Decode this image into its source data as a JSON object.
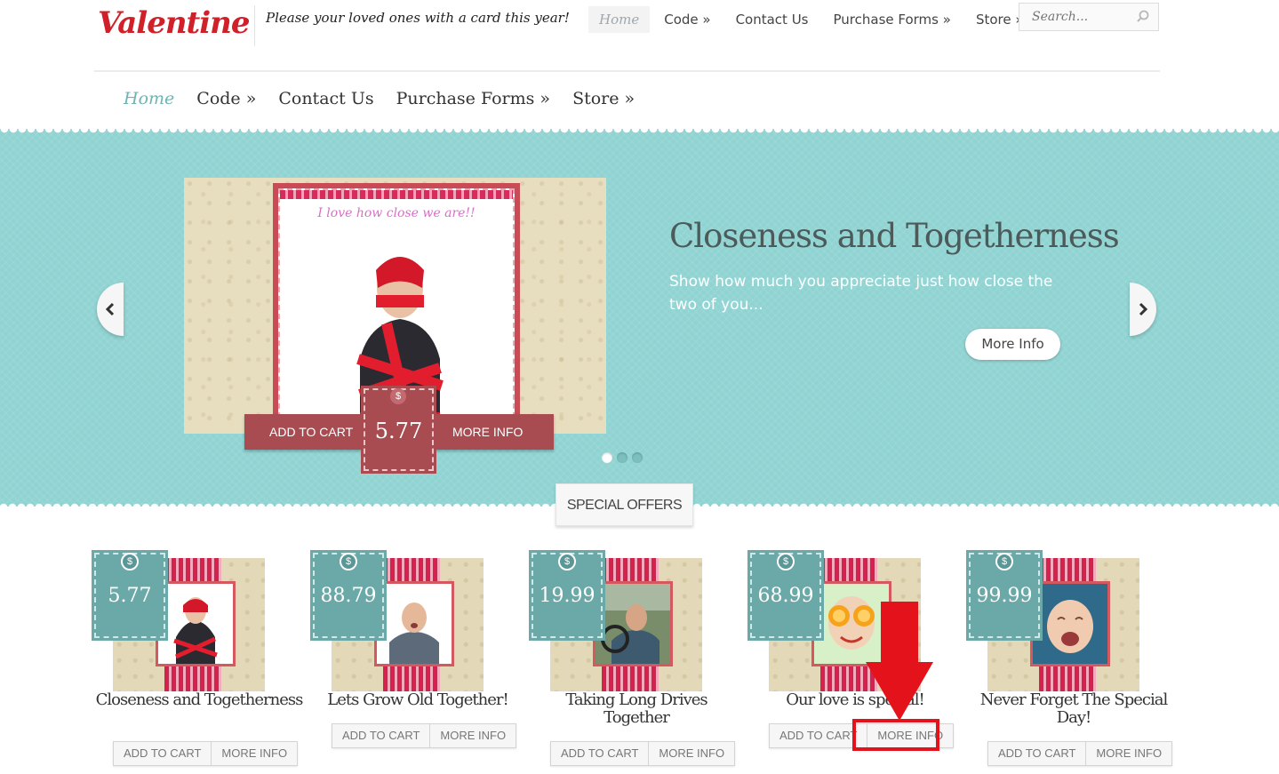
{
  "header": {
    "logo": "Valentine",
    "tagline": "Please your loved ones with a card this year!",
    "topnav": [
      {
        "label": "Home"
      },
      {
        "label": "Code »"
      },
      {
        "label": "Contact Us"
      },
      {
        "label": "Purchase Forms »"
      },
      {
        "label": "Store »"
      }
    ],
    "search_placeholder": "Search..."
  },
  "mainnav": [
    {
      "label": "Home"
    },
    {
      "label": "Code »"
    },
    {
      "label": "Contact Us"
    },
    {
      "label": "Purchase Forms »"
    },
    {
      "label": "Store »"
    }
  ],
  "slider": {
    "card_caption": "I love how close we are!!",
    "add_to_cart": "ADD TO CART",
    "price_symbol": "$",
    "price": "5.77",
    "more_info": "MORE INFO",
    "title": "Closeness and Togetherness",
    "description": "Show how much you appreciate just how close the two of you...",
    "button": "More Info",
    "dots": 3,
    "active_dot": 1
  },
  "special_offers_label": "SPECIAL OFFERS",
  "products": [
    {
      "price": "5.77",
      "name": "Closeness and Togetherness",
      "add": "ADD TO CART",
      "more": "MORE INFO"
    },
    {
      "price": "88.79",
      "name": "Lets Grow Old Together!",
      "add": "ADD TO CART",
      "more": "MORE INFO"
    },
    {
      "price": "19.99",
      "name": "Taking Long Drives Together",
      "add": "ADD TO CART",
      "more": "MORE INFO"
    },
    {
      "price": "68.99",
      "name": "Our love is special!",
      "add": "ADD TO CART",
      "more": "MORE INFO"
    },
    {
      "price": "99.99",
      "name": "Never Forget The Special Day!",
      "add": "ADD TO CART",
      "more": "MORE INFO"
    }
  ],
  "colors": {
    "teal_band": "#8fd3d2",
    "brand_red": "#d0202a",
    "ribbon": "#a84c52",
    "price_tag_teal": "#6ba8a8",
    "annotation_red": "#e3121b"
  }
}
